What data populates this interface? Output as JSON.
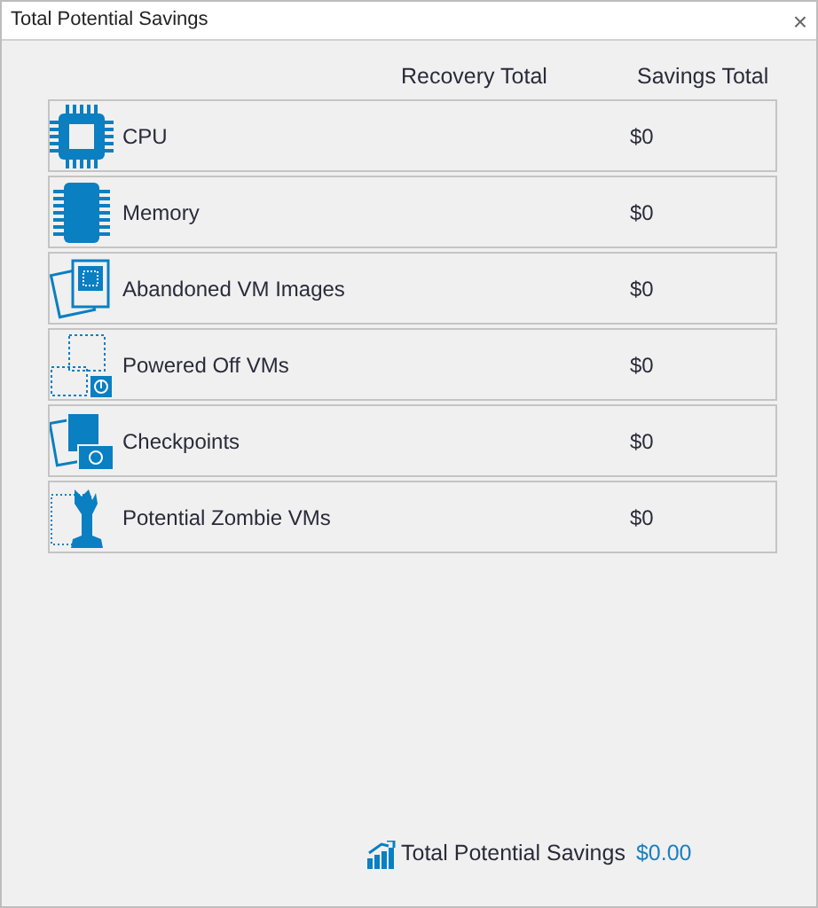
{
  "window": {
    "title": "Total Potential Savings",
    "close": "×"
  },
  "columns": [
    "Recovery Total",
    "Savings Total"
  ],
  "rows": [
    {
      "kind": "cpu",
      "label": "CPU",
      "savings": "$0"
    },
    {
      "kind": "memory",
      "label": "Memory",
      "savings": "$0"
    },
    {
      "kind": "images",
      "label": "Abandoned VM Images",
      "savings": "$0"
    },
    {
      "kind": "poweredoff",
      "label": "Powered Off VMs",
      "savings": "$0"
    },
    {
      "kind": "checkpoints",
      "label": "Checkpoints",
      "savings": "$0"
    },
    {
      "kind": "zombie",
      "label": "Potential Zombie VMs",
      "savings": "$0"
    }
  ],
  "footer": {
    "label": "Total Potential Savings",
    "value": "$0.00"
  }
}
